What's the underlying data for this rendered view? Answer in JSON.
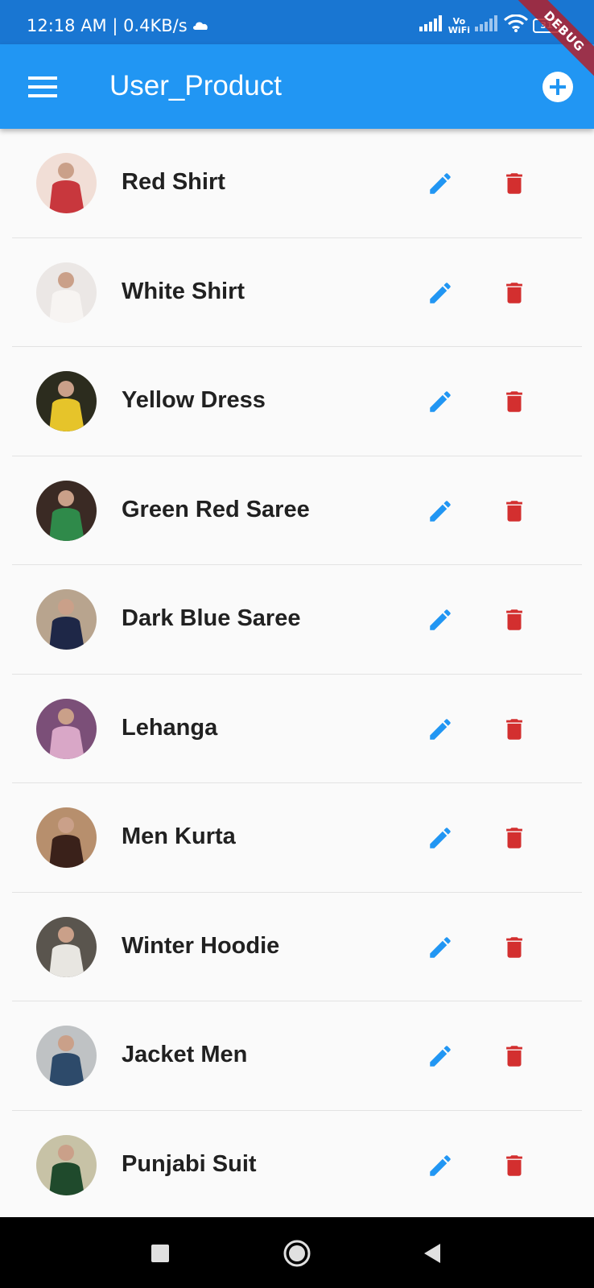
{
  "status_bar": {
    "time": "12:18 AM | 0.4KB/s",
    "vowifi_top": "Vo",
    "vowifi_bottom": "WiFi",
    "battery": "31",
    "icons": [
      "cloud-icon",
      "signal-icon",
      "signal-icon",
      "wifi-icon",
      "battery-icon"
    ]
  },
  "debug_banner": "DEBUG",
  "app_bar": {
    "title": "User_Product",
    "menu_icon": "menu-icon",
    "add_icon": "add-circle-icon"
  },
  "products": [
    {
      "name": "Red Shirt",
      "thumb_bg": "#f1ded6",
      "thumb_fg": "#c8373d"
    },
    {
      "name": "White Shirt",
      "thumb_bg": "#ebe7e5",
      "thumb_fg": "#f7f4f2"
    },
    {
      "name": "Yellow Dress",
      "thumb_bg": "#2c2c1e",
      "thumb_fg": "#e6c42a"
    },
    {
      "name": "Green Red Saree",
      "thumb_bg": "#3a2a24",
      "thumb_fg": "#2f8a4a"
    },
    {
      "name": "Dark Blue Saree",
      "thumb_bg": "#b8a48e",
      "thumb_fg": "#1e2747"
    },
    {
      "name": "Lehanga",
      "thumb_bg": "#7b4f78",
      "thumb_fg": "#d9a7c7"
    },
    {
      "name": "Men Kurta",
      "thumb_bg": "#b78f6d",
      "thumb_fg": "#3a211a"
    },
    {
      "name": "Winter Hoodie",
      "thumb_bg": "#5a554e",
      "thumb_fg": "#e8e6e1"
    },
    {
      "name": "Jacket Men",
      "thumb_bg": "#bfc2c4",
      "thumb_fg": "#2d4a6a"
    },
    {
      "name": "Punjabi Suit",
      "thumb_bg": "#c7c2a6",
      "thumb_fg": "#1f4a2c"
    }
  ],
  "colors": {
    "status_bar": "#1976d2",
    "app_bar": "#2196f3",
    "edit_icon": "#2196f3",
    "delete_icon": "#d32f2f"
  },
  "nav_bar": {
    "icons": [
      "recents-square-icon",
      "home-circle-icon",
      "back-triangle-icon"
    ]
  }
}
